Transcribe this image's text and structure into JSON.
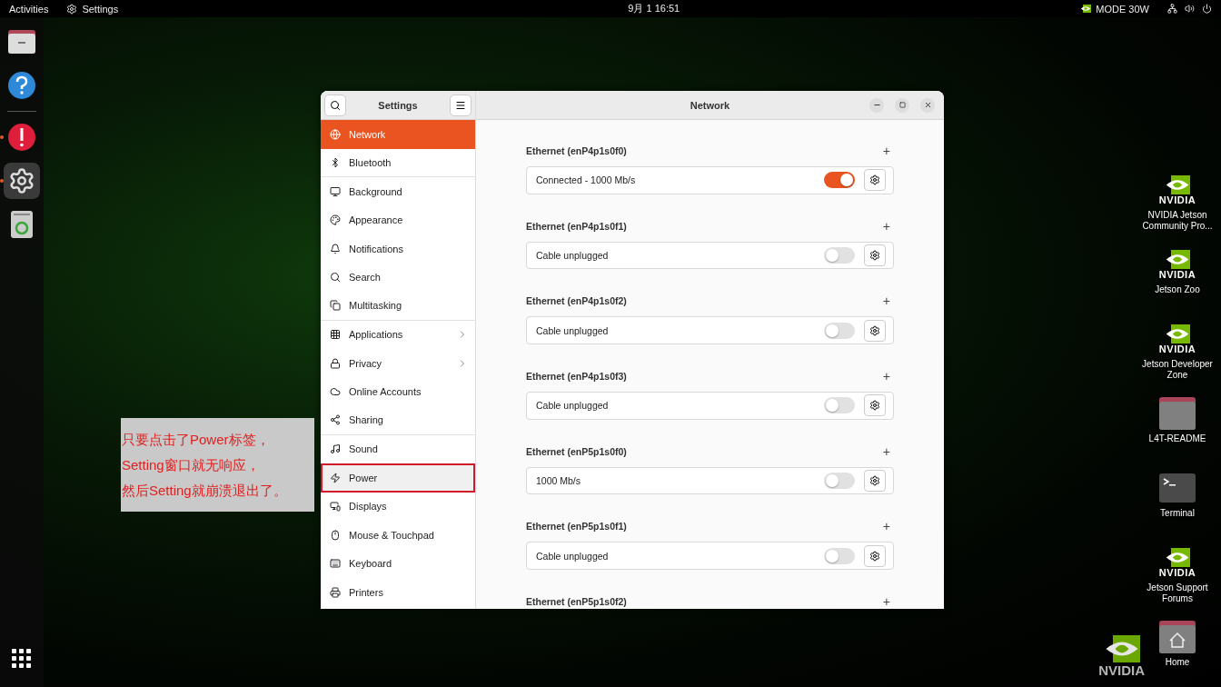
{
  "top_bar": {
    "activities": "Activities",
    "app_name": "Settings",
    "clock": "9月 1  16:51",
    "power_mode": "MODE 30W"
  },
  "dock": [
    {
      "kind": "files",
      "running": false,
      "active": false
    },
    {
      "kind": "help",
      "running": false,
      "active": false
    },
    {
      "kind": "alert",
      "running": true,
      "active": false
    },
    {
      "kind": "settings",
      "running": true,
      "active": true
    },
    {
      "kind": "trash",
      "running": false,
      "active": false
    }
  ],
  "window": {
    "sidebar_title": "Settings",
    "title": "Network",
    "sidebar_items": [
      {
        "label": "Network",
        "selected": true,
        "has_arrow": false,
        "divider_after": false,
        "highlighted": false
      },
      {
        "label": "Bluetooth",
        "selected": false,
        "has_arrow": false,
        "divider_after": true,
        "highlighted": false
      },
      {
        "label": "Background",
        "selected": false,
        "has_arrow": false,
        "divider_after": false,
        "highlighted": false
      },
      {
        "label": "Appearance",
        "selected": false,
        "has_arrow": false,
        "divider_after": false,
        "highlighted": false
      },
      {
        "label": "Notifications",
        "selected": false,
        "has_arrow": false,
        "divider_after": false,
        "highlighted": false
      },
      {
        "label": "Search",
        "selected": false,
        "has_arrow": false,
        "divider_after": false,
        "highlighted": false
      },
      {
        "label": "Multitasking",
        "selected": false,
        "has_arrow": false,
        "divider_after": true,
        "highlighted": false
      },
      {
        "label": "Applications",
        "selected": false,
        "has_arrow": true,
        "divider_after": false,
        "highlighted": false
      },
      {
        "label": "Privacy",
        "selected": false,
        "has_arrow": true,
        "divider_after": false,
        "highlighted": false
      },
      {
        "label": "Online Accounts",
        "selected": false,
        "has_arrow": false,
        "divider_after": false,
        "highlighted": false
      },
      {
        "label": "Sharing",
        "selected": false,
        "has_arrow": false,
        "divider_after": true,
        "highlighted": false
      },
      {
        "label": "Sound",
        "selected": false,
        "has_arrow": false,
        "divider_after": false,
        "highlighted": false
      },
      {
        "label": "Power",
        "selected": false,
        "has_arrow": false,
        "divider_after": false,
        "highlighted": true
      },
      {
        "label": "Displays",
        "selected": false,
        "has_arrow": false,
        "divider_after": false,
        "highlighted": false
      },
      {
        "label": "Mouse & Touchpad",
        "selected": false,
        "has_arrow": false,
        "divider_after": false,
        "highlighted": false
      },
      {
        "label": "Keyboard",
        "selected": false,
        "has_arrow": false,
        "divider_after": false,
        "highlighted": false
      },
      {
        "label": "Printers",
        "selected": false,
        "has_arrow": false,
        "divider_after": false,
        "highlighted": false
      }
    ],
    "sections": [
      {
        "title": "Ethernet (enP4p1s0f0)",
        "add": "+",
        "status": "Connected - 1000 Mb/s",
        "on": true
      },
      {
        "title": "Ethernet (enP4p1s0f1)",
        "add": "+",
        "status": "Cable unplugged",
        "on": false
      },
      {
        "title": "Ethernet (enP4p1s0f2)",
        "add": "+",
        "status": "Cable unplugged",
        "on": false
      },
      {
        "title": "Ethernet (enP4p1s0f3)",
        "add": "+",
        "status": "Cable unplugged",
        "on": false
      },
      {
        "title": "Ethernet (enP5p1s0f0)",
        "add": "+",
        "status": "1000 Mb/s",
        "on": false
      },
      {
        "title": "Ethernet (enP5p1s0f1)",
        "add": "+",
        "status": "Cable unplugged",
        "on": false
      },
      {
        "title": "Ethernet (enP5p1s0f2)",
        "add": "+"
      }
    ]
  },
  "annotation": {
    "lines": [
      "只要点击了Power标签，",
      "Setting窗口就无响应，",
      "然后Setting就崩溃退出了。"
    ]
  },
  "desktop_icons": [
    {
      "kind": "nvidia",
      "logo_text": "NVIDIA",
      "label": "NVIDIA Jetson Community Pro..."
    },
    {
      "kind": "nvidia",
      "logo_text": "NVIDIA",
      "label": "Jetson Zoo"
    },
    {
      "kind": "nvidia",
      "logo_text": "NVIDIA",
      "label": "Jetson Developer Zone"
    },
    {
      "kind": "folder",
      "label": "L4T-README"
    },
    {
      "kind": "terminal",
      "label": "Terminal"
    },
    {
      "kind": "nvidia",
      "logo_text": "NVIDIA",
      "label": "Jetson Support Forums"
    },
    {
      "kind": "home",
      "label": "Home"
    }
  ],
  "wallpaper": {
    "logo_text": "NVIDIA"
  }
}
